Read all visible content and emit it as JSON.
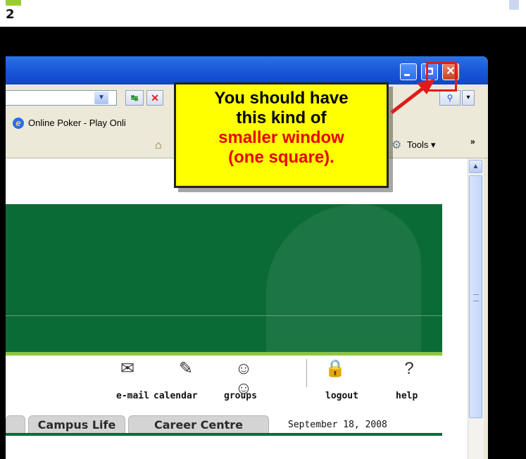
{
  "step_number": "2",
  "browser": {
    "favorites_link": "Online Poker - Play Onli",
    "tools_label": "Tools",
    "tools_arrow": "▾",
    "overflow_chevron": "»"
  },
  "page": {
    "nav_icons": [
      {
        "label": "e-mail",
        "icon": "envelope-icon"
      },
      {
        "label": "calendar",
        "icon": "calendar-icon"
      },
      {
        "label": "groups",
        "icon": "groups-icon"
      },
      {
        "label": "logout",
        "icon": "lock-icon"
      },
      {
        "label": "help",
        "icon": "question-mark-icon"
      }
    ],
    "tabs": [
      "Campus Life",
      "Career Centre"
    ],
    "date": "September 18, 2008"
  },
  "callout": {
    "line1": "You should have",
    "line2": "this kind of",
    "line3": "smaller window",
    "line4": "(one square)."
  },
  "colors": {
    "banner_green": "#0b6b36",
    "accent_lime": "#8cc63f",
    "callout_yellow": "#ffff00",
    "callout_red": "#e80000",
    "highlight_red": "#e11b1b"
  }
}
